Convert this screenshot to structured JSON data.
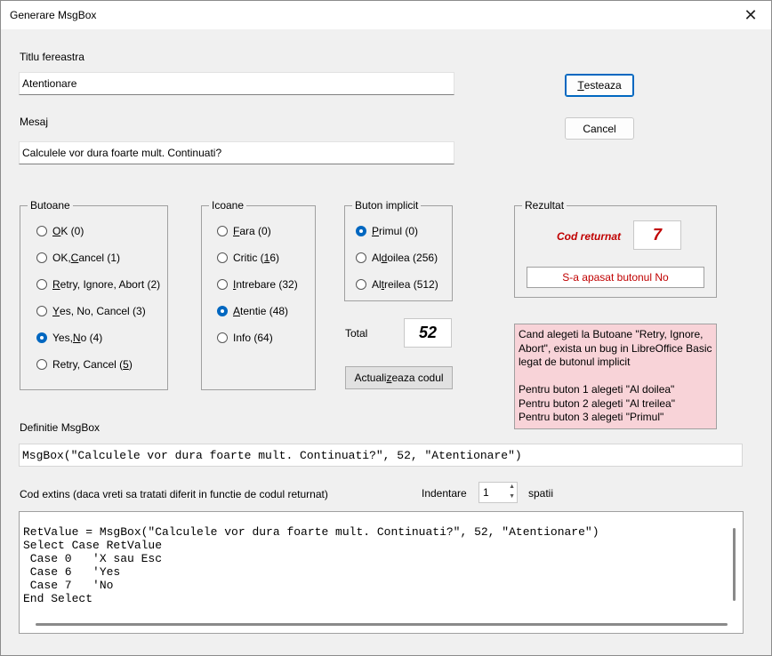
{
  "window": {
    "title": "Generare MsgBox",
    "close_glyph": "✕"
  },
  "fields": {
    "title_label": "Titlu fereastra",
    "title_value": "Atentionare",
    "message_label": "Mesaj",
    "message_value": "Calculele vor dura foarte mult. Continuati?"
  },
  "buttons": {
    "test": {
      "pre": "",
      "u": "T",
      "post": "esteaza"
    },
    "cancel": "Cancel",
    "update_code": {
      "pre": "Actuali",
      "u": "z",
      "post": "eaza codul"
    }
  },
  "groups": {
    "butoane": {
      "title": "Butoane",
      "items": [
        {
          "pre": "",
          "u": "O",
          "post": "K (0)",
          "checked": false
        },
        {
          "pre": "OK, ",
          "u": "C",
          "post": "ancel (1)",
          "checked": false
        },
        {
          "pre": "",
          "u": "R",
          "post": "etry, Ignore, Abort (2)",
          "checked": false
        },
        {
          "pre": "",
          "u": "Y",
          "post": "es, No, Cancel (3)",
          "checked": false
        },
        {
          "pre": "Yes, ",
          "u": "N",
          "post": "o (4)",
          "checked": true
        },
        {
          "pre": "Retry, Cancel (",
          "u": "5",
          "post": ")",
          "checked": false
        }
      ]
    },
    "icoane": {
      "title": "Icoane",
      "items": [
        {
          "pre": "",
          "u": "F",
          "post": "ara (0)",
          "checked": false
        },
        {
          "pre": "Critic (",
          "u": "1",
          "post": "6)",
          "checked": false
        },
        {
          "pre": "",
          "u": "I",
          "post": "ntrebare (32)",
          "checked": false
        },
        {
          "pre": "",
          "u": "A",
          "post": "tentie (48)",
          "checked": true
        },
        {
          "pre": "Info (64)",
          "u": "",
          "post": "",
          "checked": false
        }
      ]
    },
    "implicit": {
      "title": "Buton implicit",
      "items": [
        {
          "pre": "",
          "u": "P",
          "post": "rimul (0)",
          "checked": true
        },
        {
          "pre": "Al ",
          "u": "d",
          "post": "oilea (256)",
          "checked": false
        },
        {
          "pre": "Al ",
          "u": "t",
          "post": "reilea (512)",
          "checked": false
        }
      ]
    },
    "rezultat": {
      "title": "Rezultat",
      "code_label": "Cod returnat",
      "code_value": "7",
      "message": "S-a apasat butonul No"
    }
  },
  "total": {
    "label": "Total",
    "value": "52"
  },
  "note": {
    "lines": [
      "Cand alegeti la Butoane \"Retry, Ignore,",
      "Abort\", exista un bug in LibreOffice  Basic",
      "legat de butonul implicit",
      "",
      "Pentru buton 1 alegeti \"Al doilea\"",
      "Pentru buton 2 alegeti \"Al treilea\"",
      "Pentru buton 3 alegeti \"Primul\""
    ]
  },
  "definition": {
    "label": "Definitie MsgBox",
    "value": "MsgBox(\"Calculele vor dura foarte mult. Continuati?\", 52, \"Atentionare\")"
  },
  "extended": {
    "label": "Cod extins (daca vreti sa tratati diferit in functie de codul returnat)",
    "indent_label": "Indentare",
    "indent_value": "1",
    "indent_unit": "spatii",
    "code_lines": [
      "RetValue = MsgBox(\"Calculele vor dura foarte mult. Continuati?\", 52, \"Atentionare\")",
      "Select Case RetValue",
      " Case 0   'X sau Esc",
      " Case 6   'Yes",
      " Case 7   'No",
      "End Select"
    ]
  },
  "colors": {
    "accent": "#0067c0",
    "result_red": "#c00000",
    "note_bg": "#f8d3d8"
  }
}
